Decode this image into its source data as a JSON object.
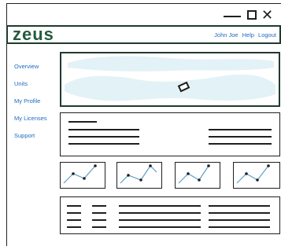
{
  "window": {
    "minimize_icon": "minimize-icon",
    "maximize_icon": "maximize-icon",
    "close_icon": "close-icon",
    "close_glyph": "✕"
  },
  "header": {
    "logo": "zeus",
    "links": [
      "John Joe",
      "Help",
      "Logout"
    ]
  },
  "sidebar": {
    "items": [
      {
        "label": "Overview"
      },
      {
        "label": "Units"
      },
      {
        "label": "My Profile"
      },
      {
        "label": "My Licenses"
      },
      {
        "label": "Support"
      }
    ]
  },
  "colors": {
    "brand": "#235b3d",
    "link": "#1e6bbf",
    "map_water": "#e3f2f6",
    "ink": "#1f1f1f"
  }
}
